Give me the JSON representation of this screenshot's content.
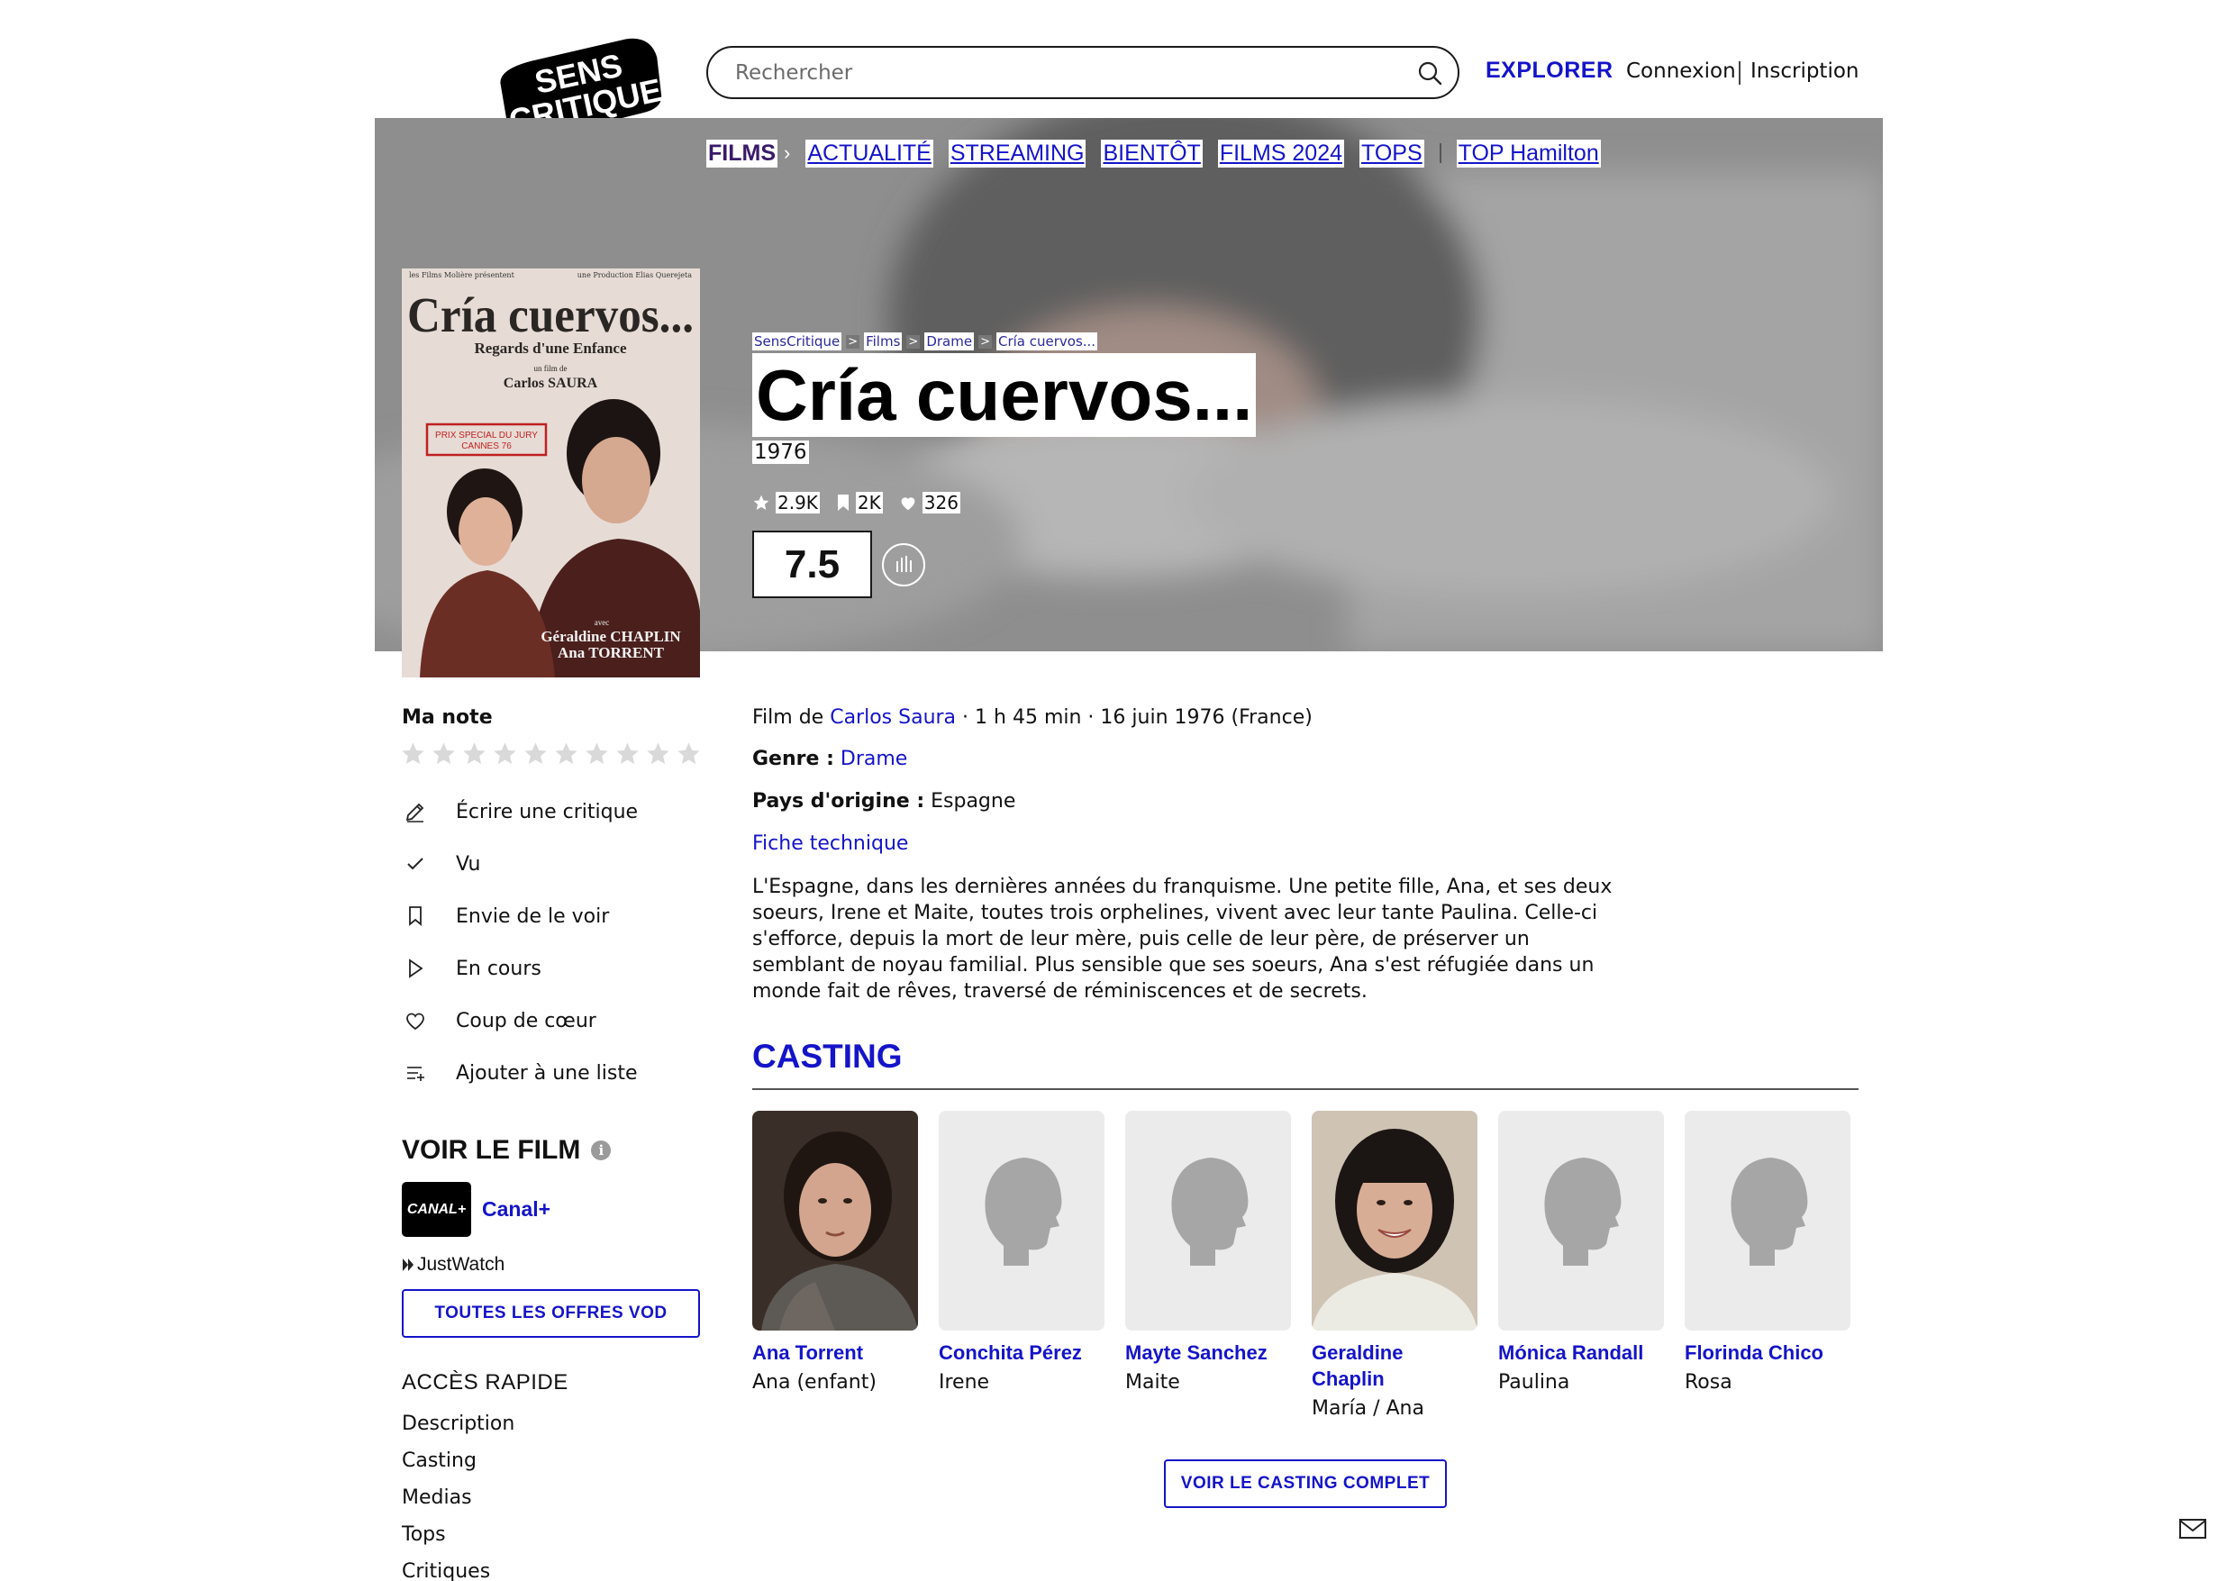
{
  "logo": {
    "line1": "SENS",
    "line2": "CRITIQUE"
  },
  "header": {
    "search_placeholder": "Rechercher",
    "explore": "EXPLORER",
    "login": "Connexion",
    "signup": "Inscription"
  },
  "nav": {
    "active": "FILMS",
    "items": [
      "ACTUALITÉ",
      "STREAMING",
      "BIENTÔT",
      "FILMS 2024",
      "TOPS"
    ],
    "extra": "TOP Hamilton"
  },
  "poster": {
    "top_left": "les Films Molière présentent",
    "top_right": "une Production Elias Querejeta",
    "title": "Cría cuervos...",
    "subtitle": "Regards d'une Enfance",
    "by": "un film de",
    "director": "Carlos SAURA",
    "prize_line1": "PRIX SPECIAL DU JURY",
    "prize_line2": "CANNES 76",
    "with": "avec",
    "actor1": "Géraldine CHAPLIN",
    "actor2": "Ana TORRENT"
  },
  "breadcrumb": [
    "SensCritique",
    "Films",
    "Drame",
    "Cría cuervos..."
  ],
  "movie": {
    "title": "Cría cuervos...",
    "year": "1976",
    "stats": {
      "ratings": "2.9K",
      "wishlist": "2K",
      "favorites": "326"
    },
    "score": "7.5"
  },
  "left": {
    "my_note": "Ma note",
    "star_count": 10,
    "actions": [
      {
        "label": "Écrire une critique",
        "icon": "pencil-icon"
      },
      {
        "label": "Vu",
        "icon": "check-icon"
      },
      {
        "label": "Envie de le voir",
        "icon": "bookmark-icon"
      },
      {
        "label": "En cours",
        "icon": "play-icon"
      },
      {
        "label": "Coup de cœur",
        "icon": "heart-icon"
      },
      {
        "label": "Ajouter à une liste",
        "icon": "list-add-icon"
      }
    ],
    "watch_title": "VOIR LE FILM",
    "info": "i",
    "provider_logo": "CANAL+",
    "provider_name": "Canal+",
    "justwatch": "JustWatch",
    "vod_button": "TOUTES LES OFFRES VOD",
    "quick_title": "ACCÈS RAPIDE",
    "quick_links": [
      "Description",
      "Casting",
      "Medias",
      "Tops",
      "Critiques"
    ]
  },
  "details": {
    "film_de": "Film de",
    "director": "Carlos Saura",
    "meta_rest": "· 1 h 45 min · 16 juin 1976 (France)",
    "genre_label": "Genre :",
    "genre": "Drame",
    "country_label": "Pays d'origine :",
    "country": "Espagne",
    "fiche": "Fiche technique",
    "synopsis": "L'Espagne, dans les dernières années du franquisme. Une petite fille, Ana, et ses deux soeurs, Irene et Maite, toutes trois orphelines, vivent avec leur tante Paulina. Celle-ci s'efforce, depuis la mort de leur mère, puis celle de leur père, de préserver un semblant de noyau familial. Plus sensible que ses soeurs, Ana s'est réfugiée dans un monde fait de rêves, traversé de réminiscences et de secrets."
  },
  "casting": {
    "title": "CASTING",
    "cast": [
      {
        "name": "Ana Torrent",
        "role": "Ana (enfant)",
        "photo": "portrait-girl"
      },
      {
        "name": "Conchita Pérez",
        "role": "Irene",
        "photo": "placeholder"
      },
      {
        "name": "Mayte Sanchez",
        "role": "Maite",
        "photo": "placeholder"
      },
      {
        "name": "Geraldine Chaplin",
        "role": "María / Ana",
        "photo": "portrait-woman"
      },
      {
        "name": "Mónica Randall",
        "role": "Paulina",
        "photo": "placeholder"
      },
      {
        "name": "Florinda Chico",
        "role": "Rosa",
        "photo": "placeholder"
      }
    ],
    "full_button": "VOIR LE CASTING COMPLET"
  },
  "colors": {
    "accent": "#1414c8",
    "hero_overlay": "#8f8f8f",
    "text": "#1a1a1a"
  }
}
